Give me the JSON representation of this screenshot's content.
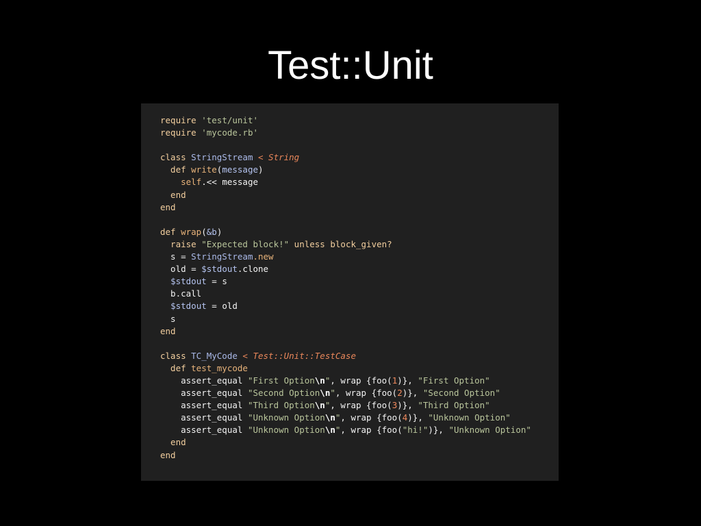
{
  "slide": {
    "title": "Test::Unit"
  },
  "code": {
    "lines": [
      [
        {
          "t": "require ",
          "c": "kw"
        },
        {
          "t": "'test/unit'",
          "c": "str"
        }
      ],
      [
        {
          "t": "require ",
          "c": "kw"
        },
        {
          "t": "'mycode.rb'",
          "c": "str"
        }
      ],
      [],
      [
        {
          "t": "class ",
          "c": "kw"
        },
        {
          "t": "StringStream",
          "c": "cls"
        },
        {
          "t": " < String",
          "c": "inh"
        }
      ],
      [
        {
          "t": "  def ",
          "c": "kw"
        },
        {
          "t": "write",
          "c": "fn"
        },
        {
          "t": "(",
          "c": "sym"
        },
        {
          "t": "message",
          "c": "var"
        },
        {
          "t": ")",
          "c": "sym"
        }
      ],
      [
        {
          "t": "    self",
          "c": "fn"
        },
        {
          "t": ".<< message",
          "c": "plain"
        }
      ],
      [
        {
          "t": "  end",
          "c": "kw"
        }
      ],
      [
        {
          "t": "end",
          "c": "kw"
        }
      ],
      [],
      [
        {
          "t": "def ",
          "c": "kw"
        },
        {
          "t": "wrap",
          "c": "fn"
        },
        {
          "t": "(",
          "c": "sym"
        },
        {
          "t": "&b",
          "c": "var"
        },
        {
          "t": ")",
          "c": "sym"
        }
      ],
      [
        {
          "t": "  raise ",
          "c": "kw"
        },
        {
          "t": "\"Expected block!\"",
          "c": "str"
        },
        {
          "t": " unless block_given?",
          "c": "kw"
        }
      ],
      [
        {
          "t": "  s = ",
          "c": "plain"
        },
        {
          "t": "StringStream",
          "c": "cls"
        },
        {
          "t": ".new",
          "c": "fn"
        }
      ],
      [
        {
          "t": "  old = ",
          "c": "plain"
        },
        {
          "t": "$stdout",
          "c": "var"
        },
        {
          "t": ".clone",
          "c": "plain"
        }
      ],
      [
        {
          "t": "  ",
          "c": "plain"
        },
        {
          "t": "$stdout",
          "c": "var"
        },
        {
          "t": " = s",
          "c": "plain"
        }
      ],
      [
        {
          "t": "  b.call",
          "c": "plain"
        }
      ],
      [
        {
          "t": "  ",
          "c": "plain"
        },
        {
          "t": "$stdout",
          "c": "var"
        },
        {
          "t": " = old",
          "c": "plain"
        }
      ],
      [
        {
          "t": "  s",
          "c": "plain"
        }
      ],
      [
        {
          "t": "end",
          "c": "kw"
        }
      ],
      [],
      [
        {
          "t": "class ",
          "c": "kw"
        },
        {
          "t": "TC_MyCode",
          "c": "cls"
        },
        {
          "t": " < Test::Unit::TestCase",
          "c": "inh"
        }
      ],
      [
        {
          "t": "  def ",
          "c": "kw"
        },
        {
          "t": "test_mycode",
          "c": "fn"
        }
      ],
      [
        {
          "t": "    assert_equal ",
          "c": "plain"
        },
        {
          "t": "\"First Option",
          "c": "str"
        },
        {
          "t": "\\n",
          "c": "esc"
        },
        {
          "t": "\"",
          "c": "str"
        },
        {
          "t": ", wrap {foo(",
          "c": "plain"
        },
        {
          "t": "1",
          "c": "num"
        },
        {
          "t": ")}, ",
          "c": "plain"
        },
        {
          "t": "\"First Option\"",
          "c": "str"
        }
      ],
      [
        {
          "t": "    assert_equal ",
          "c": "plain"
        },
        {
          "t": "\"Second Option",
          "c": "str"
        },
        {
          "t": "\\n",
          "c": "esc"
        },
        {
          "t": "\"",
          "c": "str"
        },
        {
          "t": ", wrap {foo(",
          "c": "plain"
        },
        {
          "t": "2",
          "c": "num"
        },
        {
          "t": ")}, ",
          "c": "plain"
        },
        {
          "t": "\"Second Option\"",
          "c": "str"
        }
      ],
      [
        {
          "t": "    assert_equal ",
          "c": "plain"
        },
        {
          "t": "\"Third Option",
          "c": "str"
        },
        {
          "t": "\\n",
          "c": "esc"
        },
        {
          "t": "\"",
          "c": "str"
        },
        {
          "t": ", wrap {foo(",
          "c": "plain"
        },
        {
          "t": "3",
          "c": "num"
        },
        {
          "t": ")}, ",
          "c": "plain"
        },
        {
          "t": "\"Third Option\"",
          "c": "str"
        }
      ],
      [
        {
          "t": "    assert_equal ",
          "c": "plain"
        },
        {
          "t": "\"Unknown Option",
          "c": "str"
        },
        {
          "t": "\\n",
          "c": "esc"
        },
        {
          "t": "\"",
          "c": "str"
        },
        {
          "t": ", wrap {foo(",
          "c": "plain"
        },
        {
          "t": "4",
          "c": "num"
        },
        {
          "t": ")}, ",
          "c": "plain"
        },
        {
          "t": "\"Unknown Option\"",
          "c": "str"
        }
      ],
      [
        {
          "t": "    assert_equal ",
          "c": "plain"
        },
        {
          "t": "\"Unknown Option",
          "c": "str"
        },
        {
          "t": "\\n",
          "c": "esc"
        },
        {
          "t": "\"",
          "c": "str"
        },
        {
          "t": ", wrap {foo(",
          "c": "plain"
        },
        {
          "t": "\"hi!\"",
          "c": "str"
        },
        {
          "t": ")}, ",
          "c": "plain"
        },
        {
          "t": "\"Unknown Option\"",
          "c": "str"
        }
      ],
      [
        {
          "t": "  end",
          "c": "kw"
        }
      ],
      [
        {
          "t": "end",
          "c": "kw"
        }
      ]
    ]
  },
  "colors": {
    "background": "#000000",
    "code_background": "#202020",
    "title": "#ffffff"
  }
}
